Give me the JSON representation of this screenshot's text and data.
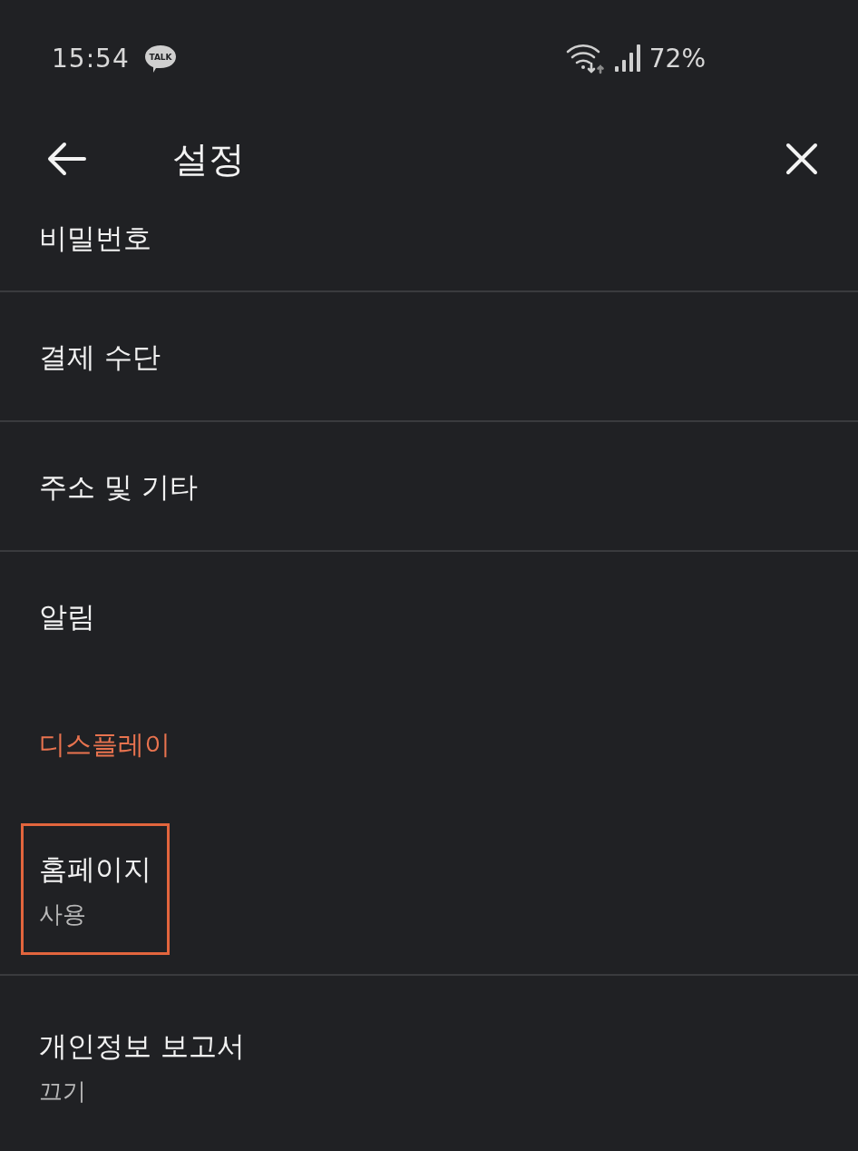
{
  "status_bar": {
    "time": "15:54",
    "notification_badge": "TALK",
    "battery": "72%"
  },
  "header": {
    "title": "설정"
  },
  "settings": [
    {
      "kind": "item",
      "title": "비밀번호",
      "highlighted": false
    },
    {
      "kind": "item",
      "title": "결제 수단",
      "highlighted": false
    },
    {
      "kind": "item",
      "title": "주소 및 기타",
      "highlighted": false
    },
    {
      "kind": "item",
      "title": "알림",
      "highlighted": false
    },
    {
      "kind": "section",
      "title": "디스플레이"
    },
    {
      "kind": "item",
      "title": "홈페이지",
      "subtitle": "사용",
      "highlighted": true
    },
    {
      "kind": "item",
      "title": "개인정보 보고서",
      "subtitle": "끄기",
      "highlighted": false
    }
  ]
}
